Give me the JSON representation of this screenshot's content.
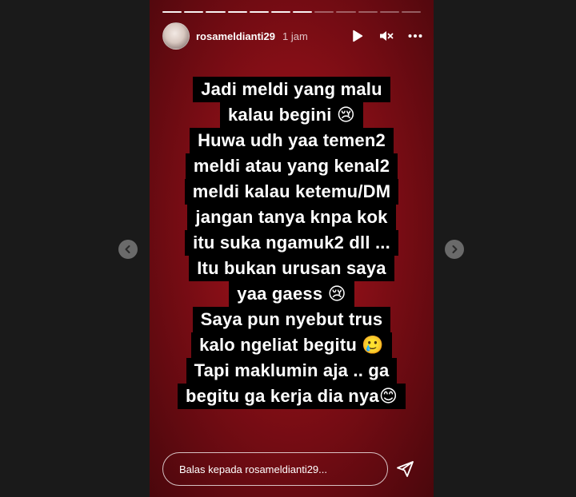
{
  "story": {
    "progress": {
      "total": 12,
      "completed": 7
    },
    "username": "rosameldianti29",
    "time": "1 jam",
    "lines": [
      "Jadi meldi yang malu",
      "kalau begini 😢",
      "Huwa udh yaa temen2",
      "meldi atau yang kenal2",
      "meldi kalau ketemu/DM",
      "jangan tanya knpa kok",
      "itu suka ngamuk2 dll ...",
      "Itu bukan urusan saya",
      "yaa gaess 😢",
      "Saya pun nyebut trus",
      "kalo ngeliat begitu 🥲",
      "Tapi maklumin aja .. ga",
      "begitu ga kerja dia nya😊"
    ]
  },
  "reply": {
    "placeholder": "Balas kepada rosameldianti29..."
  },
  "icons": {
    "play": "play-icon",
    "mute": "speaker-muted-icon",
    "more": "more-horizontal-icon",
    "send": "send-icon",
    "prev": "chevron-left-icon",
    "next": "chevron-right-icon"
  },
  "colors": {
    "background": "#1a1a1a",
    "story_red": "#8a0f17",
    "text_highlight": "#000000"
  }
}
